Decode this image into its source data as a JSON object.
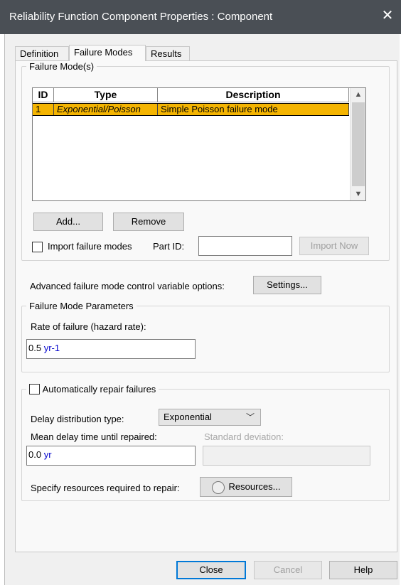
{
  "window": {
    "title": "Reliability Function Component Properties : Component",
    "close_glyph": "✕"
  },
  "tabs": [
    {
      "label": "Definition",
      "active": false
    },
    {
      "label": "Failure Modes",
      "active": true
    },
    {
      "label": "Results",
      "active": false
    }
  ],
  "failure_modes_group": {
    "legend": "Failure Mode(s)",
    "table": {
      "columns": [
        "ID",
        "Type",
        "Description"
      ],
      "rows": [
        {
          "id": "1",
          "type": "Exponential/Poisson",
          "description": "Simple Poisson failure mode",
          "selected": true
        }
      ]
    },
    "add_label": "Add...",
    "remove_label": "Remove",
    "import_checkbox_label": "Import failure modes",
    "import_checked": false,
    "part_id_label": "Part ID:",
    "part_id_value": "",
    "import_now_label": "Import Now"
  },
  "advanced": {
    "label": "Advanced failure mode control variable options:",
    "settings_label": "Settings..."
  },
  "parameters_group": {
    "legend": "Failure Mode Parameters",
    "rate_label": "Rate of failure (hazard rate):",
    "rate_value": "0.5",
    "rate_unit": "yr-1"
  },
  "repair_group": {
    "checkbox_label": "Automatically repair failures",
    "checked": false,
    "delay_type_label": "Delay distribution type:",
    "delay_type_value": "Exponential",
    "mean_delay_label": "Mean delay time until repaired:",
    "mean_delay_value": "0.0",
    "mean_delay_unit": "yr",
    "std_dev_label": "Standard deviation:",
    "std_dev_value": "",
    "resources_prompt": "Specify resources required to repair:",
    "resources_label": "Resources..."
  },
  "footer": {
    "close_label": "Close",
    "cancel_label": "Cancel",
    "help_label": "Help"
  },
  "colors": {
    "titlebar": "#4a4f55",
    "selected_row": "#f4b400",
    "unit_text": "#0000cc",
    "focus_border": "#0078d7"
  }
}
